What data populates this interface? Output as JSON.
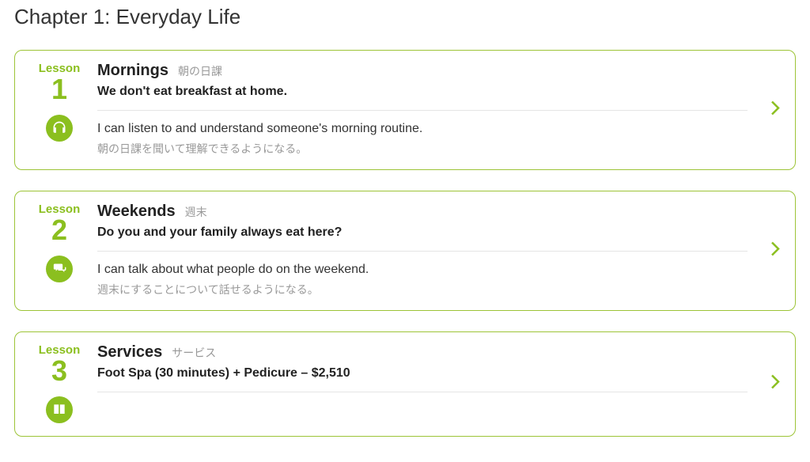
{
  "chapter": {
    "title": "Chapter 1: Everyday Life"
  },
  "lessonLabel": "Lesson",
  "lessons": [
    {
      "number": "1",
      "iconName": "headphones-icon",
      "title": "Mornings",
      "titleJp": "朝の日課",
      "sentence": "We don't eat breakfast at home.",
      "goal": "I can listen to and understand someone's morning routine.",
      "goalJp": "朝の日課を聞いて理解できるようになる。"
    },
    {
      "number": "2",
      "iconName": "speech-bubbles-icon",
      "title": "Weekends",
      "titleJp": "週末",
      "sentence": "Do you and your family always eat here?",
      "goal": "I can talk about what people do on the weekend.",
      "goalJp": "週末にすることについて話せるようになる。"
    },
    {
      "number": "3",
      "iconName": "reading-icon",
      "title": "Services",
      "titleJp": "サービス",
      "sentence": "Foot Spa (30 minutes) + Pedicure – $2,510",
      "goal": "",
      "goalJp": ""
    }
  ]
}
